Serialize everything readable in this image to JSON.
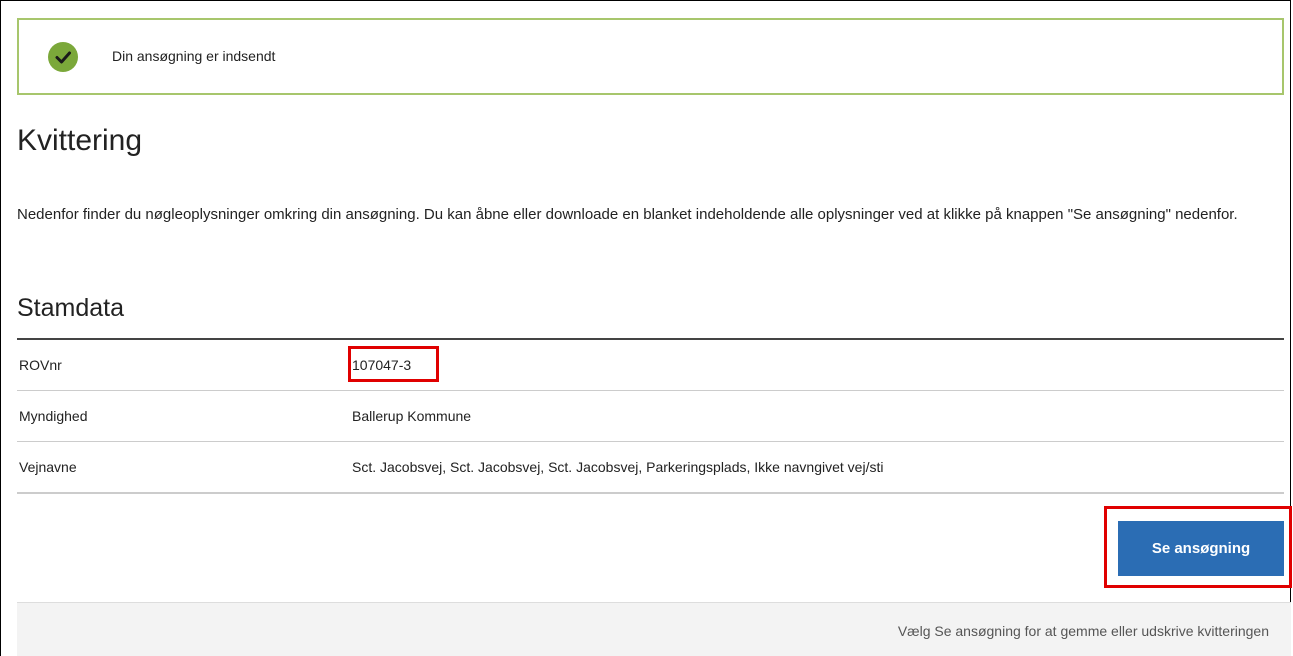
{
  "notification": {
    "icon": "checkmark-circle-icon",
    "text": "Din ansøgning er indsendt",
    "accent_color": "#7ba83a"
  },
  "page": {
    "title": "Kvittering",
    "intro": "Nedenfor finder du nøgleoplysninger omkring din ansøgning. Du kan åbne eller downloade en blanket indeholdende alle oplysninger ved at klikke på knappen \"Se ansøgning\" nedenfor."
  },
  "stamdata": {
    "title": "Stamdata",
    "rows": [
      {
        "label": "ROVnr",
        "value": "107047-3"
      },
      {
        "label": "Myndighed",
        "value": "Ballerup Kommune"
      },
      {
        "label": "Vejnavne",
        "value": "Sct. Jacobsvej, Sct. Jacobsvej, Sct. Jacobsvej, Parkeringsplads, Ikke navngivet vej/sti"
      }
    ]
  },
  "actions": {
    "view_button_label": "Se ansøgning",
    "button_color": "#2b6db4"
  },
  "footer": {
    "text": "Vælg Se ansøgning for at gemme eller udskrive kvitteringen"
  }
}
